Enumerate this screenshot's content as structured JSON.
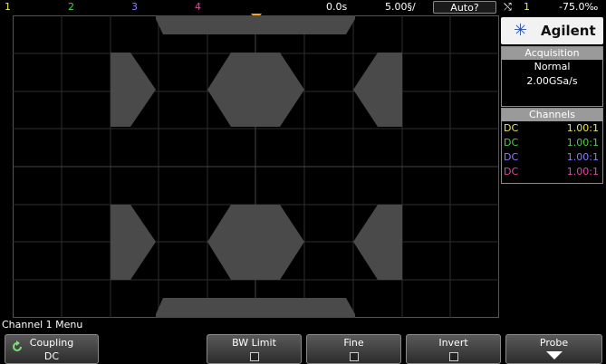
{
  "topbar": {
    "ch1": "1",
    "ch2": "2",
    "ch3": "3",
    "ch4": "4",
    "time_offset": "0.0s",
    "time_scale": "5.00§/",
    "trigger_mode": "Auto?",
    "trigger_source": "1",
    "trigger_level": "-75.0‰"
  },
  "colors": {
    "ch1": "#e8e85a",
    "ch2": "#4fd14f",
    "ch3": "#8a7dff",
    "ch4": "#e04aa0",
    "trigger_marker": "#f5a623",
    "eye_fill": "#4a4a4a"
  },
  "logo": {
    "brand": "Agilent"
  },
  "acquisition": {
    "title": "Acquisition",
    "mode": "Normal",
    "rate": "2.00GSa/s"
  },
  "channels_panel": {
    "title": "Channels",
    "rows": [
      {
        "coupling": "DC",
        "ratio": "1.00:1"
      },
      {
        "coupling": "DC",
        "ratio": "1.00:1"
      },
      {
        "coupling": "DC",
        "ratio": "1.00:1"
      },
      {
        "coupling": "DC",
        "ratio": "1.00:1"
      }
    ]
  },
  "menu": {
    "title": "Channel 1 Menu",
    "coupling_label": "Coupling",
    "coupling_value": "DC",
    "bw_limit_label": "BW Limit",
    "fine_label": "Fine",
    "invert_label": "Invert",
    "probe_label": "Probe"
  }
}
